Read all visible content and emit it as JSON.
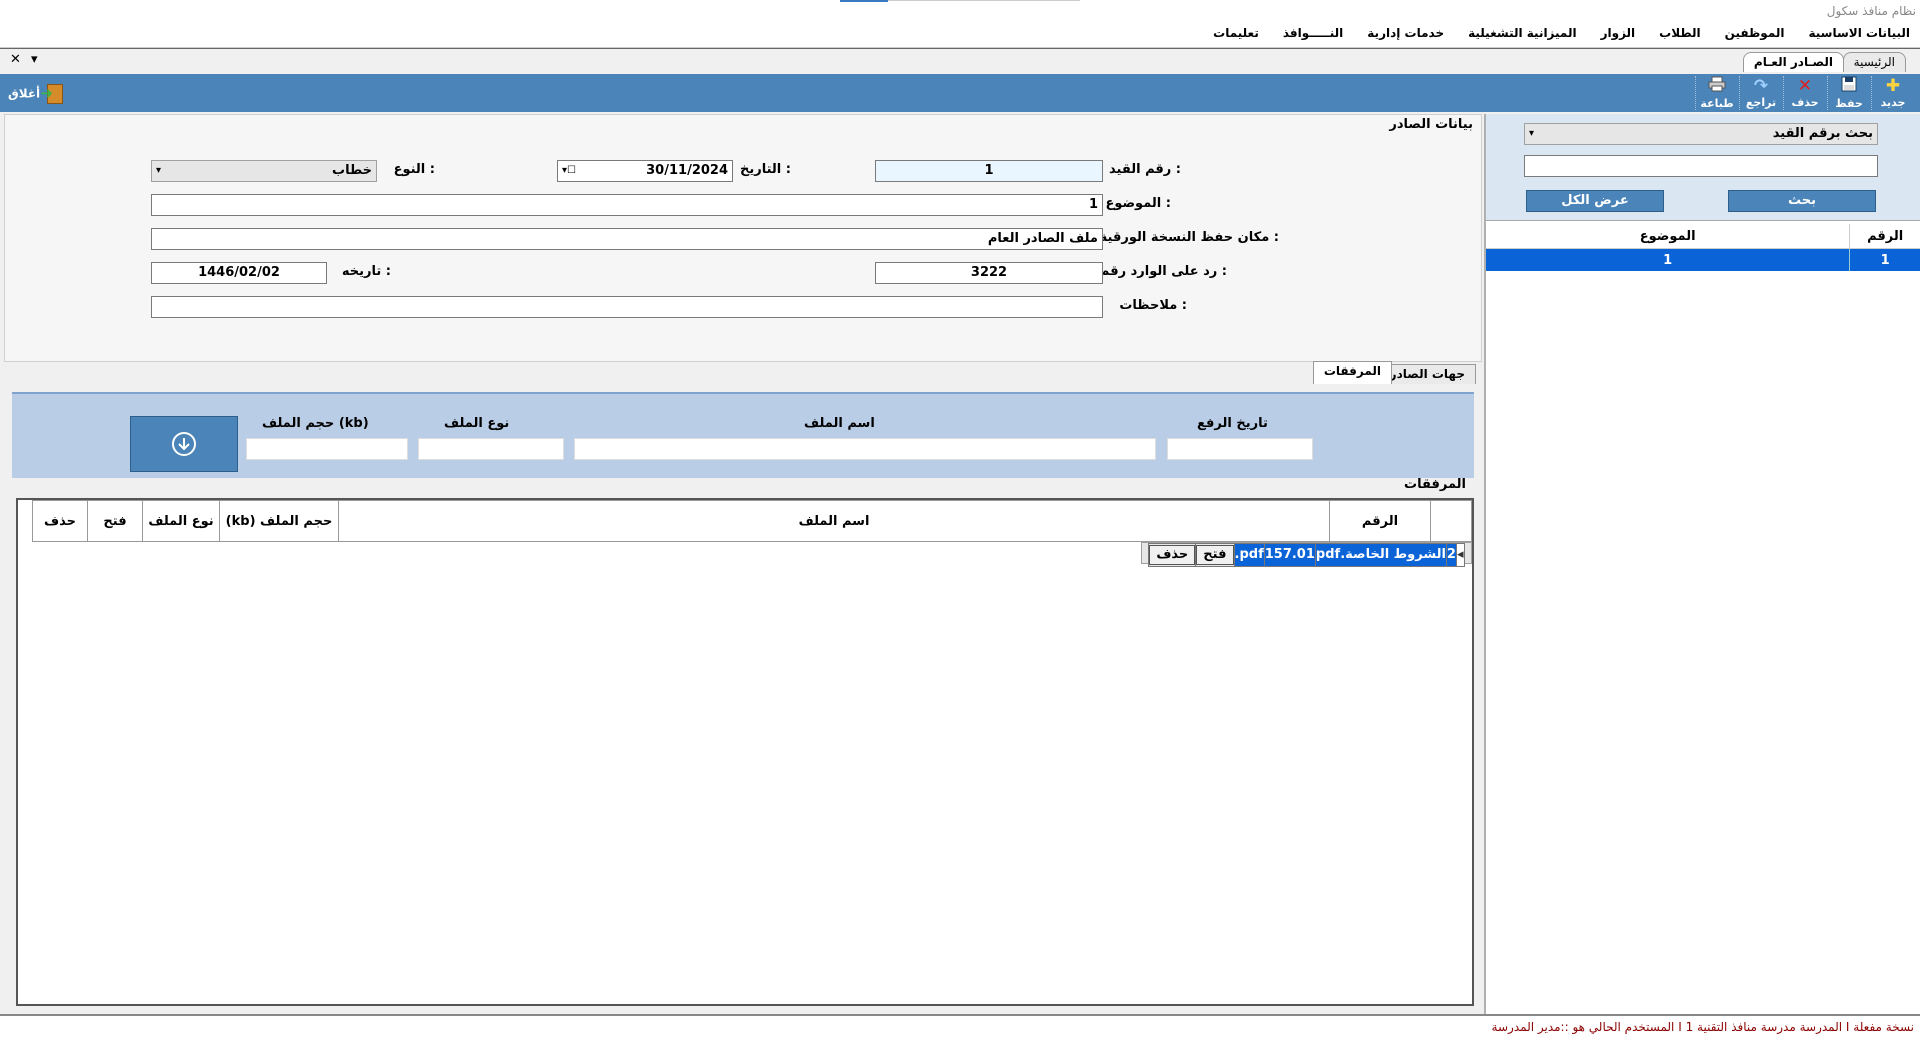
{
  "window": {
    "title": "نظام منافذ سكول"
  },
  "menu": {
    "items": [
      "البيانات الاساسية",
      "الموظفين",
      "الطلاب",
      "الزوار",
      "الميزانية التشغيلية",
      "خدمات إدارية",
      "النـــــوافذ",
      "تعليمات"
    ]
  },
  "tabs": {
    "home": "الرئيسية",
    "active": "الصـادر العـام",
    "close_symbol": "✕",
    "dropdown_symbol": "▾"
  },
  "toolbar": {
    "new": "جديد",
    "save": "حفظ",
    "delete": "حذف",
    "undo": "تراجع",
    "print": "طباعة",
    "close": "أغلاق"
  },
  "form": {
    "section_title": "بيانات الصادر",
    "entry_no_label": "رقم القيد :",
    "entry_no": "1",
    "date_label": "التاريخ :",
    "date": "30/11/2024",
    "type_label": "النوع :",
    "type": "خطاب",
    "subject_label": "الموضوع :",
    "subject": "1",
    "paper_location_label": "مكان حفظ النسخة الورقية :",
    "paper_location": "ملف الصادر العام",
    "reply_to_label": "رد على الوارد رقم :",
    "reply_to": "3222",
    "reply_date_label": "تاريخه :",
    "reply_date": "1446/02/02",
    "notes_label": "ملاحظات :",
    "notes": ""
  },
  "subtabs": {
    "recipients": "جهات الصادر",
    "attachments": "المرفقات"
  },
  "upload": {
    "upload_date_label": "تاريخ الرفع",
    "file_name_label": "اسم الملف",
    "file_type_label": "نوع الملف",
    "file_size_label": "حجم الملف (kb)"
  },
  "attachments": {
    "title": "المرفقات",
    "columns": {
      "no": "الرقم",
      "name": "اسم الملف",
      "size": "حجم الملف (kb)",
      "type": "نوع الملف",
      "open": "فتح",
      "delete": "حذف"
    },
    "rows": [
      {
        "no": "2",
        "name": "الشروط الخاصة.pdf",
        "size": "157.01",
        "type": "pdf.",
        "open": "فتح",
        "delete": "حذف"
      }
    ]
  },
  "search": {
    "mode": "بحث برقم القيد",
    "query": "",
    "search_button": "بحث",
    "show_all_button": "عرض الكل",
    "columns": {
      "no": "الرقم",
      "subject": "الموضوع"
    },
    "rows": [
      {
        "no": "1",
        "subject": "1"
      }
    ]
  },
  "status": {
    "text": "المستخدم الحالي هو ::مدير المدرسة  I  1 المدرسة  مدرسة منافذ التقنية  I  نسخة مفعلة"
  },
  "colors": {
    "toolbar": "#4a84b8",
    "selection": "#0a64d8",
    "upload_bar": "#b9cde6",
    "status_text": "#8b0000"
  }
}
